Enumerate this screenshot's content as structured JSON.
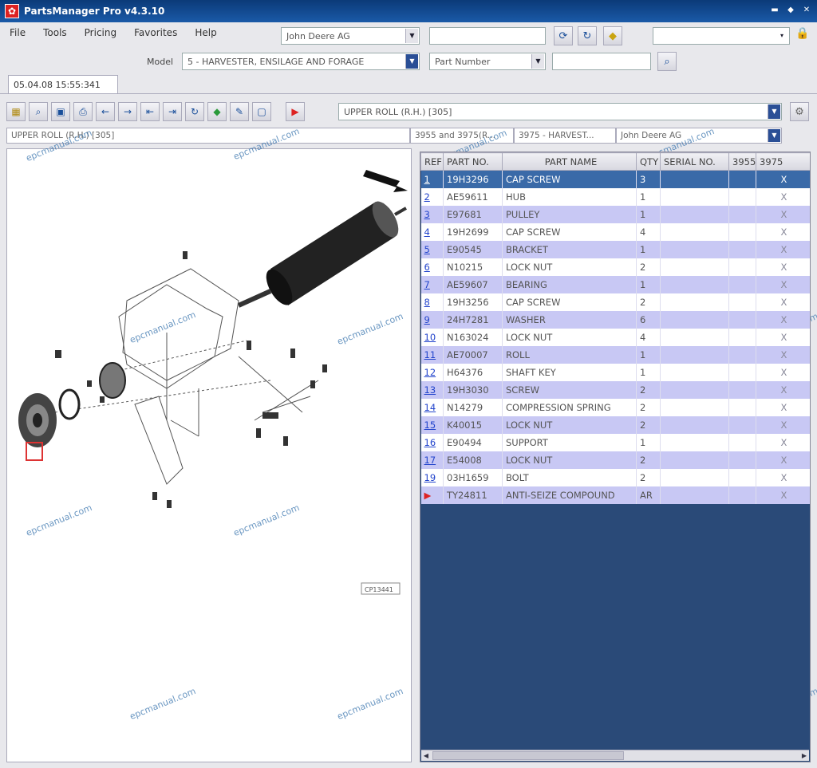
{
  "window": {
    "title": "PartsManager Pro v4.3.10"
  },
  "menu": [
    "File",
    "Tools",
    "Pricing",
    "Favorites",
    "Help"
  ],
  "search": {
    "catalog": "John Deere AG",
    "model_label": "Model",
    "model_value": "5 - HARVESTER, ENSILAGE AND FORAGE",
    "search_by": "Part Number",
    "search_text": "",
    "top_field": ""
  },
  "tab": {
    "label": "05.04.08 15:55:341"
  },
  "group": {
    "value": "UPPER ROLL (R.H.) [305]"
  },
  "info": {
    "section": "UPPER ROLL (R.H.) [305]",
    "models": "3955 and 3975(R...",
    "machine": "3975 - HARVEST...",
    "brand": "John Deere AG"
  },
  "drawing": {
    "caption": "CP13441"
  },
  "watermark": "epcmanual.com",
  "table": {
    "headers": [
      "REF",
      "PART NO.",
      "PART NAME",
      "QTY",
      "SERIAL NO.",
      "3955",
      "3975"
    ],
    "rows": [
      {
        "ref": "1",
        "part": "19H3296",
        "name": "CAP SCREW",
        "qty": "3",
        "serial": "",
        "a": "",
        "b": "X"
      },
      {
        "ref": "2",
        "part": "AE59611",
        "name": "HUB",
        "qty": "1",
        "serial": "",
        "a": "",
        "b": "X"
      },
      {
        "ref": "3",
        "part": "E97681",
        "name": "PULLEY",
        "qty": "1",
        "serial": "",
        "a": "",
        "b": "X"
      },
      {
        "ref": "4",
        "part": "19H2699",
        "name": "CAP SCREW",
        "qty": "4",
        "serial": "",
        "a": "",
        "b": "X"
      },
      {
        "ref": "5",
        "part": "E90545",
        "name": "BRACKET",
        "qty": "1",
        "serial": "",
        "a": "",
        "b": "X"
      },
      {
        "ref": "6",
        "part": "N10215",
        "name": "LOCK NUT",
        "qty": "2",
        "serial": "",
        "a": "",
        "b": "X"
      },
      {
        "ref": "7",
        "part": "AE59607",
        "name": "BEARING",
        "qty": "1",
        "serial": "",
        "a": "",
        "b": "X"
      },
      {
        "ref": "8",
        "part": "19H3256",
        "name": "CAP SCREW",
        "qty": "2",
        "serial": "",
        "a": "",
        "b": "X"
      },
      {
        "ref": "9",
        "part": "24H7281",
        "name": "WASHER",
        "qty": "6",
        "serial": "",
        "a": "",
        "b": "X"
      },
      {
        "ref": "10",
        "part": "N163024",
        "name": "LOCK NUT",
        "qty": "4",
        "serial": "",
        "a": "",
        "b": "X"
      },
      {
        "ref": "11",
        "part": "AE70007",
        "name": "ROLL",
        "qty": "1",
        "serial": "",
        "a": "",
        "b": "X"
      },
      {
        "ref": "12",
        "part": "H64376",
        "name": "SHAFT KEY",
        "qty": "1",
        "serial": "",
        "a": "",
        "b": "X"
      },
      {
        "ref": "13",
        "part": "19H3030",
        "name": "SCREW",
        "qty": "2",
        "serial": "",
        "a": "",
        "b": "X"
      },
      {
        "ref": "14",
        "part": "N14279",
        "name": "COMPRESSION SPRING",
        "qty": "2",
        "serial": "",
        "a": "",
        "b": "X"
      },
      {
        "ref": "15",
        "part": "K40015",
        "name": "LOCK NUT",
        "qty": "2",
        "serial": "",
        "a": "",
        "b": "X"
      },
      {
        "ref": "16",
        "part": "E90494",
        "name": "SUPPORT",
        "qty": "1",
        "serial": "",
        "a": "",
        "b": "X"
      },
      {
        "ref": "17",
        "part": "E54008",
        "name": "LOCK NUT",
        "qty": "2",
        "serial": "",
        "a": "",
        "b": "X"
      },
      {
        "ref": "19",
        "part": "03H1659",
        "name": "BOLT",
        "qty": "2",
        "serial": "",
        "a": "",
        "b": "X"
      },
      {
        "ref": "",
        "part": "TY24811",
        "name": "ANTI-SEIZE COMPOUND",
        "qty": "AR",
        "serial": "",
        "a": "",
        "b": "X"
      }
    ]
  }
}
